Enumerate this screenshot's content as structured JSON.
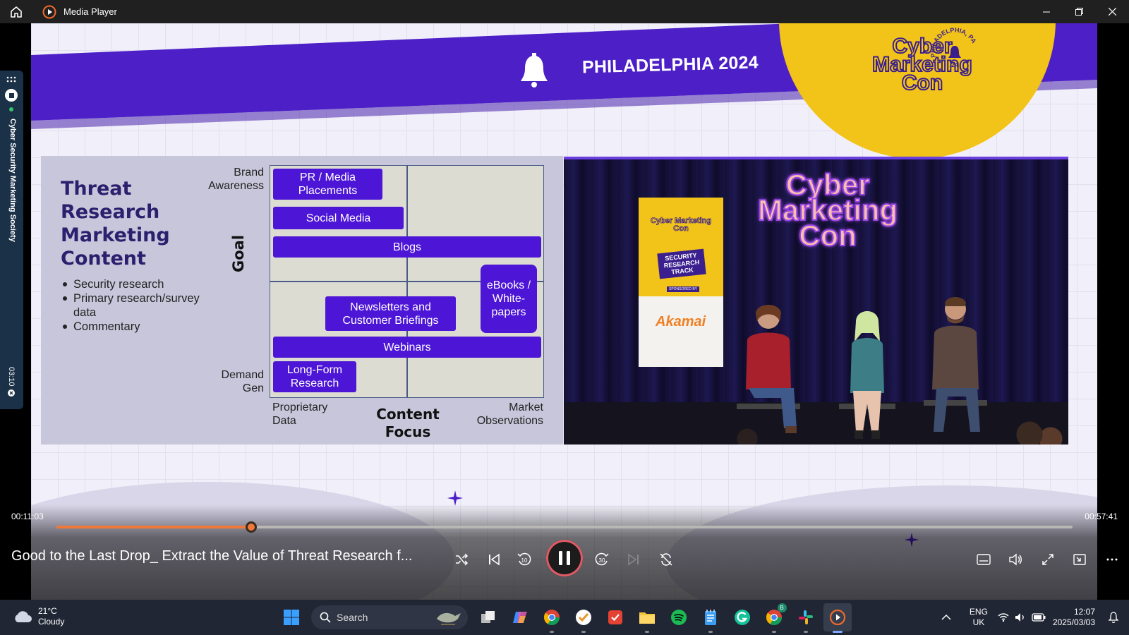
{
  "window": {
    "title": "Media Player"
  },
  "slide": {
    "banner_text": "PHILADELPHIA 2024",
    "logo_text_line1": "Cyber",
    "logo_text_line2": "Marketing",
    "logo_text_line3": "Con",
    "logo_stamp": "PHILADELPHIA, PA",
    "logo_stamp_num": "24",
    "title": "Threat Research Marketing Content",
    "bullets": [
      "Security research",
      "Primary research/survey data",
      "Commentary"
    ],
    "y_axis_label": "Goal",
    "y_top": "Brand Awareness",
    "y_bottom": "Demand Gen",
    "x_axis_label": "Content Focus",
    "x_left": "Proprietary Data",
    "x_right": "Market Observations",
    "chips": {
      "pr": "PR / Media Placements",
      "social": "Social Media",
      "blogs": "Blogs",
      "ebooks": "eBooks / White-papers",
      "newsletters": "Newsletters and Customer Briefings",
      "webinars": "Webinars",
      "longform": "Long-Form Research"
    }
  },
  "camera": {
    "stage_logo_line1": "Cyber",
    "stage_logo_line2": "Marketing",
    "stage_logo_line3": "Con",
    "banner_logo": "Cyber Marketing Con",
    "banner_track": "SECURITY RESEARCH TRACK",
    "banner_sponsored": "SPONSORED BY",
    "banner_sponsor": "Akamai"
  },
  "player": {
    "elapsed": "00:11:03",
    "total": "00:57:41",
    "progress": 0.1916,
    "video_title": "Good to the Last Drop_ Extract the Value of Threat Research f...",
    "accent": "#f0793a"
  },
  "sidepanel": {
    "label": "Cyber Security Marketing Society",
    "time": "03:10"
  },
  "taskbar": {
    "weather_temp": "21°C",
    "weather_desc": "Cloudy",
    "search_placeholder": "Search",
    "lang_line1": "ENG",
    "lang_line2": "UK",
    "time": "12:07",
    "date": "2025/03/03",
    "chrome_badge": "B"
  }
}
